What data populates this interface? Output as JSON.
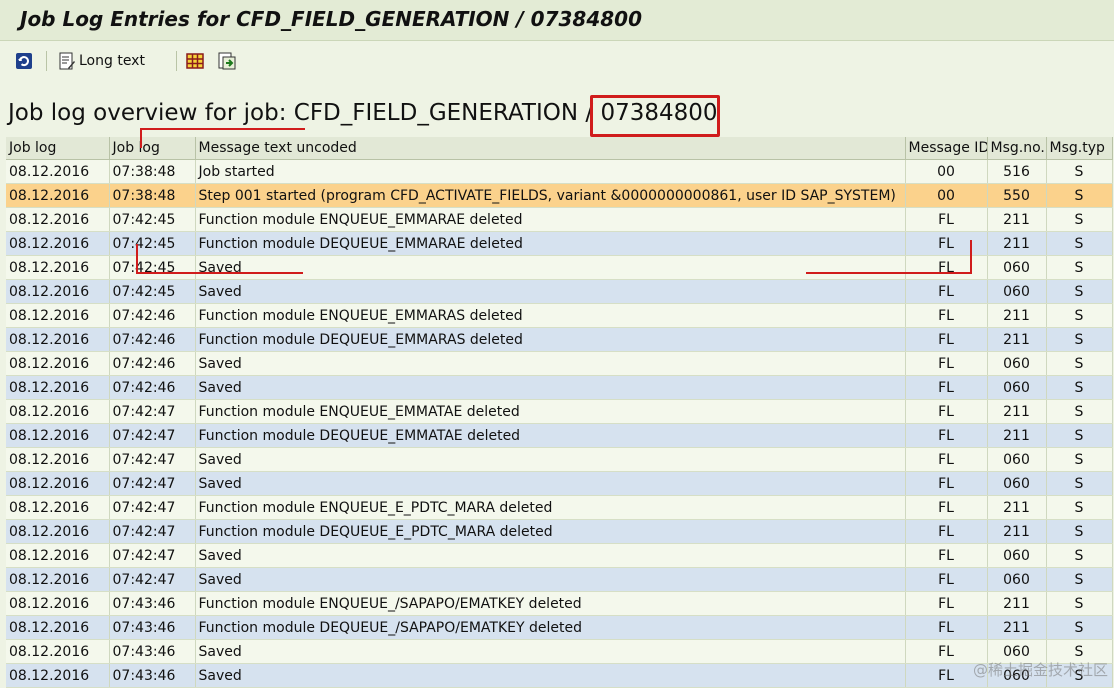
{
  "window": {
    "title": "Job Log Entries for CFD_FIELD_GENERATION / 07384800"
  },
  "toolbar": {
    "long_text_label": "Long text"
  },
  "overview": {
    "heading_prefix": "Job log overview for job: CFD_FIELD_GENERATION /",
    "job_number": "07384800"
  },
  "table": {
    "columns": [
      "Job log",
      "Job log",
      "Message text uncoded",
      "Message ID",
      "Msg.no.",
      "Msg.typ"
    ],
    "rows": [
      [
        "08.12.2016",
        "07:38:48",
        "Job started",
        "00",
        "516",
        "S"
      ],
      [
        "08.12.2016",
        "07:38:48",
        "Step 001 started (program CFD_ACTIVATE_FIELDS, variant &0000000000861, user ID SAP_SYSTEM)",
        "00",
        "550",
        "S"
      ],
      [
        "08.12.2016",
        "07:42:45",
        "Function module ENQUEUE_EMMARAE deleted",
        "FL",
        "211",
        "S"
      ],
      [
        "08.12.2016",
        "07:42:45",
        "Function module DEQUEUE_EMMARAE deleted",
        "FL",
        "211",
        "S"
      ],
      [
        "08.12.2016",
        "07:42:45",
        "Saved",
        "FL",
        "060",
        "S"
      ],
      [
        "08.12.2016",
        "07:42:45",
        "Saved",
        "FL",
        "060",
        "S"
      ],
      [
        "08.12.2016",
        "07:42:46",
        "Function module ENQUEUE_EMMARAS deleted",
        "FL",
        "211",
        "S"
      ],
      [
        "08.12.2016",
        "07:42:46",
        "Function module DEQUEUE_EMMARAS deleted",
        "FL",
        "211",
        "S"
      ],
      [
        "08.12.2016",
        "07:42:46",
        "Saved",
        "FL",
        "060",
        "S"
      ],
      [
        "08.12.2016",
        "07:42:46",
        "Saved",
        "FL",
        "060",
        "S"
      ],
      [
        "08.12.2016",
        "07:42:47",
        "Function module ENQUEUE_EMMATAE deleted",
        "FL",
        "211",
        "S"
      ],
      [
        "08.12.2016",
        "07:42:47",
        "Function module DEQUEUE_EMMATAE deleted",
        "FL",
        "211",
        "S"
      ],
      [
        "08.12.2016",
        "07:42:47",
        "Saved",
        "FL",
        "060",
        "S"
      ],
      [
        "08.12.2016",
        "07:42:47",
        "Saved",
        "FL",
        "060",
        "S"
      ],
      [
        "08.12.2016",
        "07:42:47",
        "Function module ENQUEUE_E_PDTC_MARA deleted",
        "FL",
        "211",
        "S"
      ],
      [
        "08.12.2016",
        "07:42:47",
        "Function module DEQUEUE_E_PDTC_MARA deleted",
        "FL",
        "211",
        "S"
      ],
      [
        "08.12.2016",
        "07:42:47",
        "Saved",
        "FL",
        "060",
        "S"
      ],
      [
        "08.12.2016",
        "07:42:47",
        "Saved",
        "FL",
        "060",
        "S"
      ],
      [
        "08.12.2016",
        "07:43:46",
        "Function module ENQUEUE_/SAPAPO/EMATKEY deleted",
        "FL",
        "211",
        "S"
      ],
      [
        "08.12.2016",
        "07:43:46",
        "Function module DEQUEUE_/SAPAPO/EMATKEY deleted",
        "FL",
        "211",
        "S"
      ],
      [
        "08.12.2016",
        "07:43:46",
        "Saved",
        "FL",
        "060",
        "S"
      ],
      [
        "08.12.2016",
        "07:43:46",
        "Saved",
        "FL",
        "060",
        "S"
      ]
    ],
    "selected_row": 1
  },
  "watermark": {
    "text": "@稀土掘金技术社区"
  },
  "colors": {
    "accent_red": "#d01c1c",
    "selected_row": "#fbd28c",
    "alt_row": "#d6e2ef",
    "row": "#f4f8ec"
  }
}
